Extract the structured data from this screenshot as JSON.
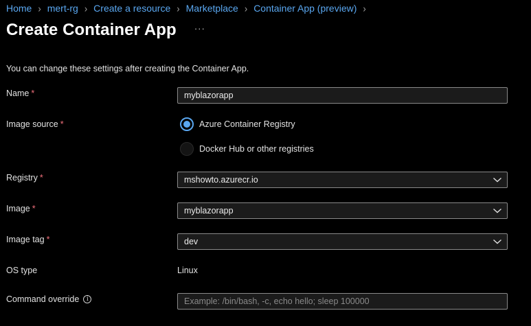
{
  "breadcrumb": {
    "items": [
      "Home",
      "mert-rg",
      "Create a resource",
      "Marketplace",
      "Container App (preview)"
    ]
  },
  "header": {
    "title": "Create Container App",
    "more": "···"
  },
  "intro_text": "You can change these settings after creating the Container App.",
  "form": {
    "name": {
      "label": "Name",
      "value": "myblazorapp"
    },
    "image_source": {
      "label": "Image source",
      "options": [
        "Azure Container Registry",
        "Docker Hub or other registries"
      ],
      "selected": "Azure Container Registry"
    },
    "registry": {
      "label": "Registry",
      "value": "mshowto.azurecr.io"
    },
    "image": {
      "label": "Image",
      "value": "myblazorapp"
    },
    "image_tag": {
      "label": "Image tag",
      "value": "dev"
    },
    "os_type": {
      "label": "OS type",
      "value": "Linux"
    },
    "command_override": {
      "label": "Command override",
      "value": "",
      "placeholder": "Example: /bin/bash, -c, echo hello; sleep 100000"
    },
    "required_marker": "*"
  },
  "colors": {
    "link": "#5aa7f0",
    "required": "#f1707b",
    "background": "#000000"
  }
}
